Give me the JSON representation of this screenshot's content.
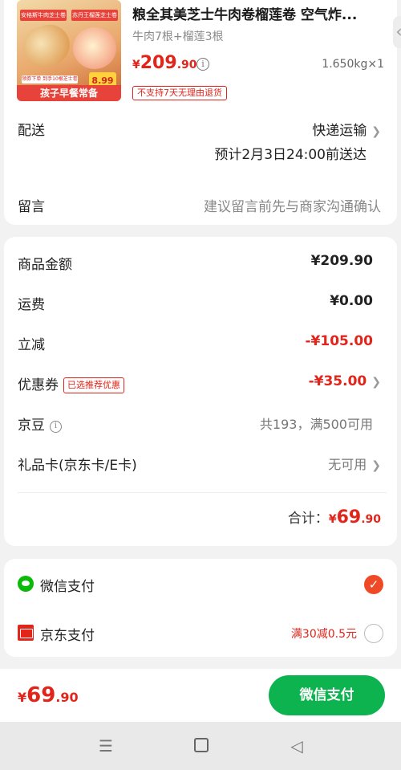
{
  "product": {
    "title": "粮全其美芝士牛肉卷榴莲卷 空气炸...",
    "spec": "牛肉7根+榴莲3根",
    "price": {
      "currency": "¥",
      "integer": "209",
      "decimal": ".90"
    },
    "weight_qty": "1.650kg×1",
    "return_badge": "不支持7天无理由退货",
    "thumb": {
      "tag_left": "安格斯牛肉芝士卷",
      "tag_right": "苏丹王榴莲芝士卷",
      "price_tag": "8.99",
      "promo": "领券下单 到手10根芝士卷",
      "banner": "孩子早餐常备"
    }
  },
  "delivery": {
    "label": "配送",
    "method": "快递运输",
    "estimate": "预计2月3日24:00前送达"
  },
  "message": {
    "label": "留言",
    "placeholder": "建议留言前先与商家沟通确认"
  },
  "amounts": {
    "goods": {
      "label": "商品金额",
      "value": "¥209.90"
    },
    "shipping": {
      "label": "运费",
      "value": "¥0.00"
    },
    "discount": {
      "label": "立减",
      "value": "-¥105.00"
    },
    "coupon": {
      "label": "优惠券",
      "tag": "已选推荐优惠",
      "value": "-¥35.00"
    },
    "jingdou": {
      "label": "京豆",
      "value": "共193，满500可用"
    },
    "giftcard": {
      "label": "礼品卡(京东卡/E卡)",
      "value": "无可用"
    },
    "total": {
      "label": "合计：",
      "currency": "¥",
      "integer": "69",
      "decimal": ".90"
    }
  },
  "payment": {
    "wechat": {
      "label": "微信支付",
      "selected": true
    },
    "jd": {
      "label": "京东支付",
      "promo": "满30减0.5元",
      "selected": false
    }
  },
  "bottom_bar": {
    "price": {
      "currency": "¥",
      "integer": "69",
      "decimal": ".90"
    },
    "pay_button": "微信支付"
  },
  "colors": {
    "price_red": "#e1251b",
    "pay_green": "#0db34e",
    "check_orange": "#ef4a27"
  }
}
